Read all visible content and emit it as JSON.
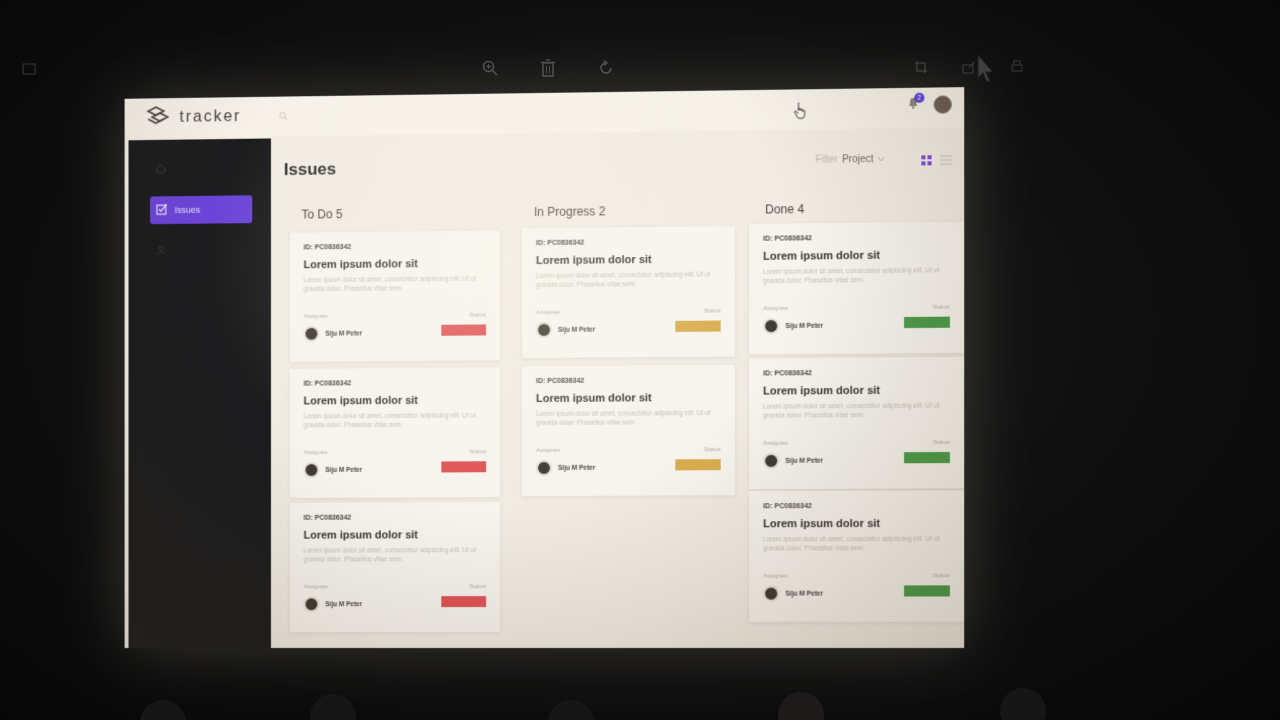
{
  "viewer": {
    "left_label": "",
    "right_labels": [
      "",
      ""
    ]
  },
  "app": {
    "logo_text": "tracker",
    "search_placeholder": "",
    "notification_count": "2"
  },
  "sidebar": {
    "items": [
      {
        "label": "",
        "icon": "dashboard-icon",
        "active": false
      },
      {
        "label": "Issues",
        "icon": "issues-icon",
        "active": true
      },
      {
        "label": "",
        "icon": "users-icon",
        "active": false
      }
    ]
  },
  "page": {
    "title": "Issues",
    "filter_label": "Filter",
    "filter_value": "Project"
  },
  "columns": [
    {
      "title": "To Do 5",
      "cards": [
        {
          "id": "ID: PC0836342",
          "title": "Lorem ipsum dolor sit",
          "desc": "Lorem ipsum dolor sit amet, consectetur adipiscing elit. Ut ut gravida dolor. Phasellus vitae sem.",
          "assignee_label": "Assignee",
          "status_label": "Status",
          "user_name": "Siju M Peter",
          "user_sub": "",
          "status_text": "",
          "status_color": "#e05355"
        },
        {
          "id": "ID: PC0836342",
          "title": "Lorem ipsum dolor sit",
          "desc": "Lorem ipsum dolor sit amet, consectetur adipiscing elit. Ut ut gravida dolor. Phasellus vitae sem.",
          "assignee_label": "Assignee",
          "status_label": "Status",
          "user_name": "Siju M Peter",
          "user_sub": "",
          "status_text": "",
          "status_color": "#e05355"
        },
        {
          "id": "ID: PC0836342",
          "title": "Lorem ipsum dolor sit",
          "desc": "Lorem ipsum dolor sit amet, consectetur adipiscing elit. Ut ut gravida dolor. Phasellus vitae sem.",
          "assignee_label": "Assignee",
          "status_label": "Status",
          "user_name": "Siju M Peter",
          "user_sub": "",
          "status_text": "",
          "status_color": "#e05355"
        }
      ]
    },
    {
      "title": "In Progress 2",
      "cards": [
        {
          "id": "ID: PC0836342",
          "title": "Lorem ipsum dolor sit",
          "desc": "Lorem ipsum dolor sit amet, consectetur adipiscing elit. Ut ut gravida dolor. Phasellus vitae sem.",
          "assignee_label": "Assignee",
          "status_label": "Status",
          "user_name": "Siju M Peter",
          "user_sub": "",
          "status_text": "",
          "status_color": "#d8ad4f"
        },
        {
          "id": "ID: PC0836342",
          "title": "Lorem ipsum dolor sit",
          "desc": "Lorem ipsum dolor sit amet, consectetur adipiscing elit. Ut ut gravida dolor. Phasellus vitae sem.",
          "assignee_label": "Assignee",
          "status_label": "Status",
          "user_name": "Siju M Peter",
          "user_sub": "",
          "status_text": "",
          "status_color": "#d8ad4f"
        }
      ]
    },
    {
      "title": "Done 4",
      "cards": [
        {
          "id": "ID: PC0836342",
          "title": "Lorem ipsum dolor sit",
          "desc": "Lorem ipsum dolor sit amet, consectetur adipiscing elit. Ut ut gravida dolor. Phasellus vitae sem.",
          "assignee_label": "Assignee",
          "status_label": "Status",
          "user_name": "Siju M Peter",
          "user_sub": "",
          "status_text": "",
          "status_color": "#4e9a49"
        },
        {
          "id": "ID: PC0836342",
          "title": "Lorem ipsum dolor sit",
          "desc": "Lorem ipsum dolor sit amet, consectetur adipiscing elit. Ut ut gravida dolor. Phasellus vitae sem.",
          "assignee_label": "Assignee",
          "status_label": "Status",
          "user_name": "Siju M Peter",
          "user_sub": "",
          "status_text": "",
          "status_color": "#4e9a49"
        },
        {
          "id": "ID: PC0836342",
          "title": "Lorem ipsum dolor sit",
          "desc": "Lorem ipsum dolor sit amet, consectetur adipiscing elit. Ut ut gravida dolor. Phasellus vitae sem.",
          "assignee_label": "Assignee",
          "status_label": "Status",
          "user_name": "Siju M Peter",
          "user_sub": "",
          "status_text": "",
          "status_color": "#4e9a49"
        }
      ]
    }
  ]
}
